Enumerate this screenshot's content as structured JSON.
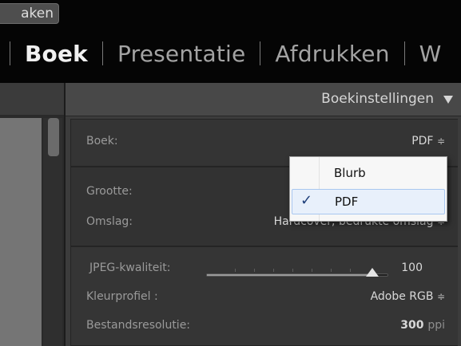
{
  "top_bar": {
    "modules": [
      {
        "label": "Boek",
        "active": true
      },
      {
        "label": "Presentatie",
        "active": false
      },
      {
        "label": "Afdrukken",
        "active": false
      },
      {
        "label": "W",
        "active": false
      }
    ]
  },
  "left_panel": {
    "button_label": "aken"
  },
  "right_panel": {
    "header_title": "Boekinstellingen",
    "book": {
      "label": "Boek:",
      "value": "PDF",
      "updown": "≑"
    },
    "size": {
      "label": "Grootte:"
    },
    "cover": {
      "label": "Omslag:",
      "value": "Hardcover, bedrukte omslag",
      "updown": "≑"
    },
    "jpeg": {
      "label": "JPEG-kwaliteit:",
      "value": "100",
      "level": 1.0
    },
    "color_profile": {
      "label": "Kleurprofiel :",
      "value": "Adobe RGB",
      "updown": "≑"
    },
    "resolution": {
      "label": "Bestandsresolutie:",
      "value": "300",
      "unit": "ppi"
    }
  },
  "dropdown": {
    "items": [
      {
        "label": "Blurb",
        "checked": false
      },
      {
        "label": "PDF",
        "checked": true
      }
    ],
    "check_glyph": "✓"
  },
  "colors": {
    "background": "#0e0e0e",
    "panel": "#3c3c3c",
    "menu_bg": "#f7f7f7",
    "menu_highlight": "#e8f0fb"
  }
}
